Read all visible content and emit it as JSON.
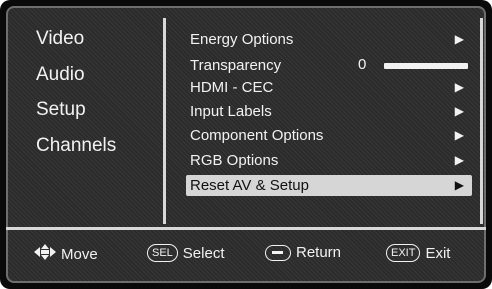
{
  "categories": [
    "Video",
    "Audio",
    "Setup",
    "Channels"
  ],
  "menu": {
    "items": [
      {
        "label": "Energy Options",
        "arrow": "▶"
      },
      {
        "label": "Transparency",
        "arrow": ""
      },
      {
        "label": "HDMI - CEC",
        "arrow": "▶"
      },
      {
        "label": "Input Labels",
        "arrow": "▶"
      },
      {
        "label": "Component Options",
        "arrow": "▶"
      },
      {
        "label": "RGB Options",
        "arrow": "▶"
      },
      {
        "label": "Reset AV & Setup",
        "arrow": "▶"
      }
    ],
    "selected_index": 6,
    "transparency_value": "0",
    "transparency_level": 0
  },
  "footer": {
    "move_label": "Move",
    "sel_key": "SEL",
    "select_label": "Select",
    "return_label": "Return",
    "exit_key": "EXIT",
    "exit_label": "Exit"
  },
  "icons": {
    "move": "four-way-arrow-icon",
    "return": "minus-button-icon",
    "arrow": "right-triangle-icon"
  },
  "colors": {
    "background": "#2b2b2b",
    "text": "#f2f2f2",
    "highlight": "#d6d6d6"
  }
}
